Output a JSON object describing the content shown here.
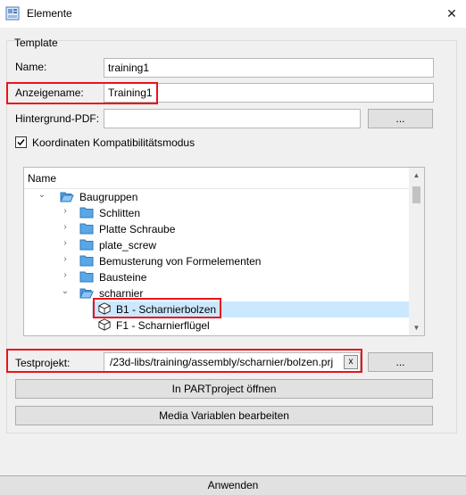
{
  "window": {
    "title": "Elemente",
    "close_glyph": "✕"
  },
  "template": {
    "group_label": "Template",
    "name_label": "Name:",
    "name_value": "training1",
    "display_label": "Anzeigename:",
    "display_value": "Training1",
    "pdf_label": "Hintergrund-PDF:",
    "pdf_value": "",
    "browse_label": "...",
    "coord_checkbox_label": "Koordinaten Kompatibilitätsmodus",
    "coord_checked": true
  },
  "tree": {
    "header": "Name",
    "items": [
      {
        "label": "Baugruppen",
        "chevron": "⌄",
        "icon": "folder-open-icon"
      },
      {
        "label": "Schlitten",
        "chevron": "›",
        "icon": "folder-icon"
      },
      {
        "label": "Platte Schraube",
        "chevron": "›",
        "icon": "folder-icon"
      },
      {
        "label": "plate_screw",
        "chevron": "›",
        "icon": "folder-icon"
      },
      {
        "label": "Bemusterung von Formelementen",
        "chevron": "›",
        "icon": "folder-icon"
      },
      {
        "label": "Bausteine",
        "chevron": "›",
        "icon": "folder-icon"
      },
      {
        "label": "scharnier",
        "chevron": "⌄",
        "icon": "folder-open-icon"
      },
      {
        "label": "B1 - Scharnierbolzen",
        "chevron": "",
        "icon": "cube-icon"
      },
      {
        "label": "F1 - Scharnierflügel",
        "chevron": "",
        "icon": "cube-icon"
      }
    ],
    "selected": "B1 - Scharnierbolzen"
  },
  "testproject": {
    "label": "Testprojekt:",
    "value": "/23d-libs/training/assembly/scharnier/bolzen.prj",
    "clear_label": "x",
    "browse_label": "..."
  },
  "buttons": {
    "open_partproject": "In PARTproject öffnen",
    "media_variables": "Media Variablen bearbeiten",
    "apply": "Anwenden"
  },
  "colors": {
    "highlight": "#e8141b",
    "selection": "#cce8ff",
    "folder": "#5aa7e6"
  }
}
